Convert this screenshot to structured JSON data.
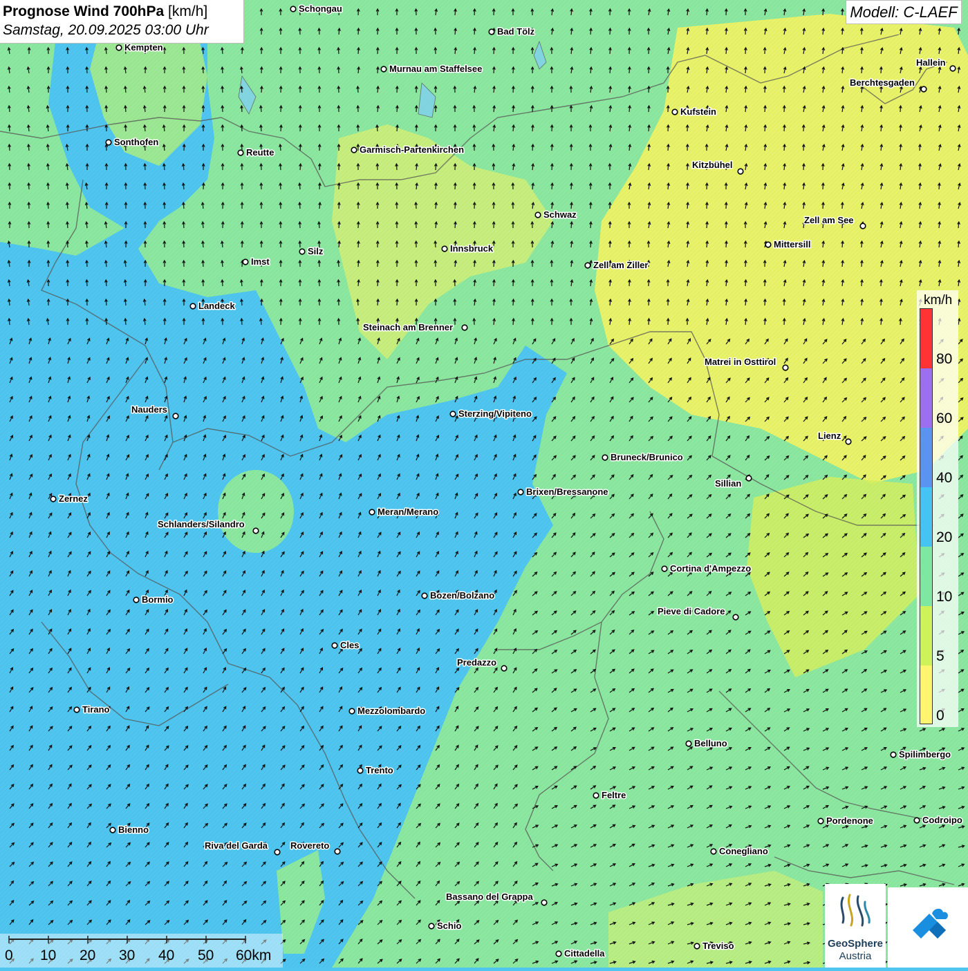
{
  "title": {
    "main": "Prognose Wind 700hPa",
    "unit": "[km/h]",
    "subtitle": "Samstag, 20.09.2025 03:00 Uhr"
  },
  "model": "Modell: C-LAEF",
  "legend": {
    "unit": "km/h",
    "labels": [
      "80",
      "60",
      "40",
      "20",
      "10",
      "5",
      "0"
    ],
    "colors": [
      "#ff3333",
      "#9b6ff0",
      "#5b93f0",
      "#45c3f2",
      "#7ee8a3",
      "#cdf25a",
      "#fff56e"
    ]
  },
  "scale": {
    "labels": [
      "0",
      "10",
      "20",
      "30",
      "40",
      "50",
      "60km"
    ]
  },
  "logos": {
    "geosphere_line1": "GeoSphere",
    "geosphere_line2": "Austria"
  },
  "cities": [
    {
      "name": "Schongau",
      "label_side": "right"
    },
    {
      "name": "Kempten",
      "label_side": "right"
    },
    {
      "name": "Bad Tölz",
      "label_side": "right"
    },
    {
      "name": "Murnau am Staffelsee",
      "label_side": "right"
    },
    {
      "name": "Hallein",
      "label_side": "left"
    },
    {
      "name": "Berchtesgaden",
      "label_side": "left"
    },
    {
      "name": "Kufstein",
      "label_side": "right"
    },
    {
      "name": "Sonthofen",
      "label_side": "right"
    },
    {
      "name": "Reutte",
      "label_side": "right"
    },
    {
      "name": "Garmisch-Partenkirchen",
      "label_side": "right"
    },
    {
      "name": "Kitzbühel",
      "label_side": "left"
    },
    {
      "name": "Schwaz",
      "label_side": "right"
    },
    {
      "name": "Zell am See",
      "label_side": "left"
    },
    {
      "name": "Mittersill",
      "label_side": "right"
    },
    {
      "name": "Innsbruck",
      "label_side": "right"
    },
    {
      "name": "Imst",
      "label_side": "right"
    },
    {
      "name": "Silz",
      "label_side": "right"
    },
    {
      "name": "Zell am Ziller",
      "label_side": "right"
    },
    {
      "name": "Landeck",
      "label_side": "right"
    },
    {
      "name": "Steinach am Brenner",
      "label_side": "left"
    },
    {
      "name": "Matrei in Osttirol",
      "label_side": "left"
    },
    {
      "name": "Nauders",
      "label_side": "left"
    },
    {
      "name": "Sterzing/Vipiteno",
      "label_side": "right"
    },
    {
      "name": "Lienz",
      "label_side": "left"
    },
    {
      "name": "Bruneck/Brunico",
      "label_side": "right"
    },
    {
      "name": "Sillian",
      "label_side": "left"
    },
    {
      "name": "Brixen/Bressanone",
      "label_side": "right"
    },
    {
      "name": "Zernez",
      "label_side": "right"
    },
    {
      "name": "Meran/Merano",
      "label_side": "right"
    },
    {
      "name": "Schlanders/Silandro",
      "label_side": "left"
    },
    {
      "name": "Cortina d'Ampezzo",
      "label_side": "right"
    },
    {
      "name": "Bozen/Bolzano",
      "label_side": "right"
    },
    {
      "name": "Bormio",
      "label_side": "right"
    },
    {
      "name": "Pieve di Cadore",
      "label_side": "left"
    },
    {
      "name": "Cles",
      "label_side": "right"
    },
    {
      "name": "Predazzo",
      "label_side": "left"
    },
    {
      "name": "Tirano",
      "label_side": "right"
    },
    {
      "name": "Mezzolombardo",
      "label_side": "right"
    },
    {
      "name": "Belluno",
      "label_side": "right"
    },
    {
      "name": "Spilimbergo",
      "label_side": "right"
    },
    {
      "name": "Trento",
      "label_side": "right"
    },
    {
      "name": "Feltre",
      "label_side": "right"
    },
    {
      "name": "Pordenone",
      "label_side": "right"
    },
    {
      "name": "Codroipo",
      "label_side": "right"
    },
    {
      "name": "Bienno",
      "label_side": "right"
    },
    {
      "name": "Riva del Garda",
      "label_side": "left"
    },
    {
      "name": "Rovereto",
      "label_side": "left"
    },
    {
      "name": "Conegliano",
      "label_side": "right"
    },
    {
      "name": "Bassano del Grappa",
      "label_side": "left"
    },
    {
      "name": "Schio",
      "label_side": "right"
    },
    {
      "name": "Treviso",
      "label_side": "right"
    },
    {
      "name": "Cittadella",
      "label_side": "right"
    }
  ]
}
